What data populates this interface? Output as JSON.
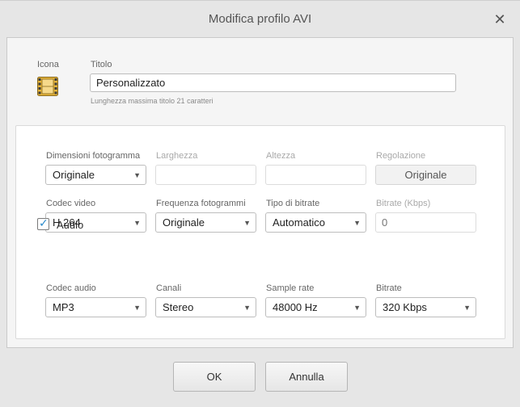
{
  "window": {
    "title": "Modifica profilo AVI"
  },
  "header": {
    "icon_label": "Icona",
    "title_label": "Titolo",
    "title_value": "Personalizzato",
    "title_hint": "Lunghezza massima titolo 21 caratteri"
  },
  "video": {
    "frame_size_label": "Dimensioni fotogramma",
    "frame_size_value": "Originale",
    "width_label": "Larghezza",
    "width_value": "",
    "height_label": "Altezza",
    "height_value": "",
    "adjust_label": "Regolazione",
    "adjust_button": "Originale",
    "codec_label": "Codec video",
    "codec_value": "H.264",
    "fps_label": "Frequenza fotogrammi",
    "fps_value": "Originale",
    "bitrate_type_label": "Tipo di bitrate",
    "bitrate_type_value": "Automatico",
    "bitrate_label": "Bitrate (Kbps)",
    "bitrate_placeholder": "0"
  },
  "audio": {
    "enabled": true,
    "checkbox_label": "Audio",
    "codec_label": "Codec audio",
    "codec_value": "MP3",
    "channels_label": "Canali",
    "channels_value": "Stereo",
    "sample_rate_label": "Sample rate",
    "sample_rate_value": "48000 Hz",
    "bitrate_label": "Bitrate",
    "bitrate_value": "320 Kbps"
  },
  "footer": {
    "ok_label": "OK",
    "cancel_label": "Annulla"
  },
  "icons": {
    "close": "close-icon",
    "profile": "film-icon",
    "dropdown": "chevron-down-icon"
  },
  "colors": {
    "accent": "#2b8acb",
    "film_yellow": "#e6b43a"
  }
}
